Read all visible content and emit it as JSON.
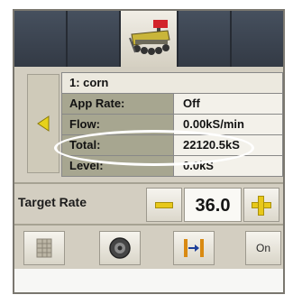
{
  "tabs": [
    {
      "icon": "blank"
    },
    {
      "icon": "blank"
    },
    {
      "icon": "planter-icon"
    },
    {
      "icon": "blank"
    },
    {
      "icon": "blank"
    }
  ],
  "product": {
    "name": "1: corn",
    "rows": [
      {
        "label": "App Rate:",
        "value": "Off"
      },
      {
        "label": "Flow:",
        "value": "0.00kS/min"
      },
      {
        "label": "Total:",
        "value": "22120.5kS"
      },
      {
        "label": "Level:",
        "value": "0.0kS"
      }
    ]
  },
  "target": {
    "label": "Target Rate",
    "value": "36.0"
  },
  "toolbar": {
    "on_label": "On"
  },
  "colors": {
    "tab_dark": "#39404c",
    "panel": "#d3cec1",
    "label_cell": "#a7a690",
    "accent_yellow": "#e8c81a",
    "arrow_yellow": "#e7d21a"
  }
}
